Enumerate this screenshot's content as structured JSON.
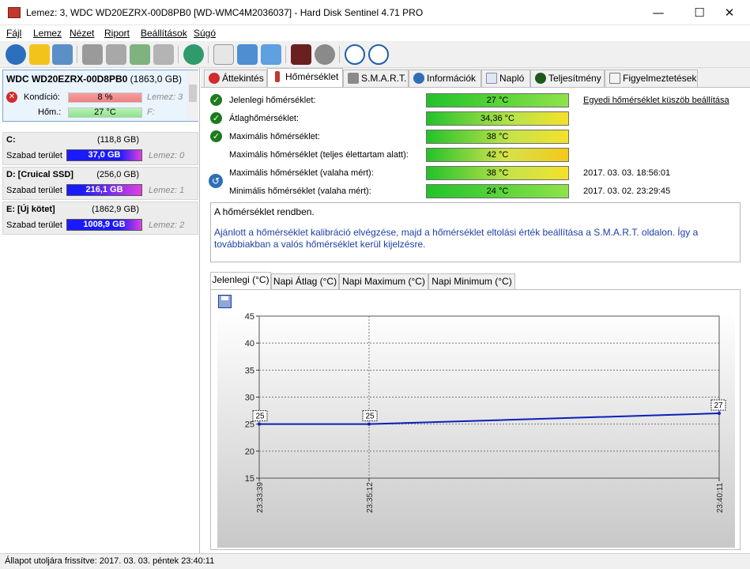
{
  "window": {
    "title": "Lemez: 3, WDC WD20EZRX-00D8PB0 [WD-WMC4M2036037]  -  Hard Disk Sentinel 4.71 PRO"
  },
  "menu": [
    "Fájl",
    "Lemez",
    "Nézet",
    "Riport",
    "Beállítások",
    "Súgó"
  ],
  "toolbar": [
    "refresh-icon",
    "warning-icon",
    "report-icon",
    "disk-icon",
    "disk-icon",
    "disk-icon",
    "disk-icon",
    "globe-icon",
    "document-icon",
    "transfer-icon",
    "network-icon",
    "chart-icon",
    "speaker-icon",
    "help-icon",
    "info-icon"
  ],
  "disk": {
    "name": "WDC WD20EZRX-00D8PB0",
    "size": "(1863,0 GB)",
    "condition_label": "Kondíció:",
    "condition_value": "8 %",
    "condition_disk": "Lemez: 3",
    "temp_label": "Hőm.:",
    "temp_value": "27 °C",
    "temp_disk": "F:"
  },
  "volumes": [
    {
      "name": "C:",
      "size": "(118,8 GB)",
      "free_label": "Szabad terület",
      "free": "37,0 GB",
      "disk": "Lemez: 0"
    },
    {
      "name": "D: [Cruical SSD]",
      "size": "(256,0 GB)",
      "free_label": "Szabad terület",
      "free": "216,1 GB",
      "disk": "Lemez: 1"
    },
    {
      "name": "E: [Új kötet]",
      "size": "(1862,9 GB)",
      "free_label": "Szabad terület",
      "free": "1008,9 GB",
      "disk": "Lemez: 2"
    }
  ],
  "tabs": [
    "Áttekintés",
    "Hőmérséklet",
    "S.M.A.R.T.",
    "Információk",
    "Napló",
    "Teljesítmény",
    "Figyelmeztetések"
  ],
  "temps": {
    "threshold_link": "Egyedi hőmérséklet küszöb beállítása",
    "rows": [
      {
        "label": "Jelenlegi hőmérséklet:",
        "value": "27 °C",
        "date": ""
      },
      {
        "label": "Átlaghőmérséklet:",
        "value": "34,36 °C",
        "date": ""
      },
      {
        "label": "Maximális hőmérséklet:",
        "value": "38 °C",
        "date": ""
      },
      {
        "label": "Maximális hőmérséklet (teljes élettartam alatt):",
        "value": "42 °C",
        "date": ""
      },
      {
        "label": "Maximális hőmérséklet (valaha mért):",
        "value": "38 °C",
        "date": "2017. 03. 03. 18:56:01"
      },
      {
        "label": "Minimális hőmérséklet (valaha mért):",
        "value": "24 °C",
        "date": "2017. 03. 02. 23:29:45"
      }
    ]
  },
  "message": {
    "status": "A hőmérséklet rendben.",
    "advice": "Ajánlott a hőmérséklet kalibráció elvégzése, majd a hőmérséklet eltolási érték beállítása a S.M.A.R.T. oldalon. Így a továbbiakban a valós hőmérséklet kerül kijelzésre."
  },
  "subtabs": [
    "Jelenlegi (°C)",
    "Napi Átlag (°C)",
    "Napi Maximum (°C)",
    "Napi Minimum (°C)"
  ],
  "chart_data": {
    "type": "line",
    "title": "",
    "xlabel": "",
    "ylabel": "",
    "ylim": [
      15,
      45
    ],
    "yticks": [
      15,
      20,
      25,
      30,
      35,
      40,
      45
    ],
    "x": [
      "23:33:39",
      "23:35:12",
      "23:40:11"
    ],
    "series": [
      {
        "name": "",
        "values": [
          25,
          25,
          27
        ]
      }
    ],
    "data_labels": [
      "25",
      "25",
      "27"
    ],
    "grid": true,
    "colors": {
      "line": "#0a1fb8",
      "background_top": "#ffffff",
      "background_bottom": "#c8c8c8"
    }
  },
  "status": {
    "text": "Állapot utoljára frissítve: 2017. 03. 03. péntek 23:40:11"
  }
}
